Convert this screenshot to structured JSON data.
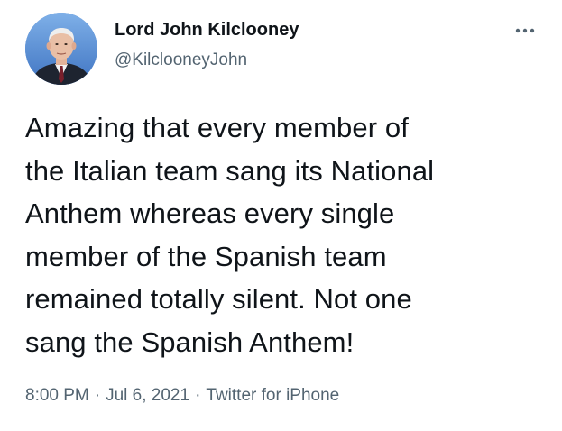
{
  "author": {
    "display_name": "Lord John Kilclooney",
    "handle": "@KilclooneyJohn",
    "avatar_icon": "profile-photo"
  },
  "more_icon": "ellipsis-icon",
  "tweet": {
    "text": "Amazing that every member of\nthe Italian team sang its National\nAnthem whereas every single\nmember of the Spanish team\nremained totally silent. Not one\nsang the Spanish Anthem!"
  },
  "meta": {
    "time": "8:00 PM",
    "separator": "·",
    "date": "Jul 6, 2021",
    "source": "Twitter for iPhone"
  },
  "colors": {
    "text_primary": "#0f1419",
    "text_secondary": "#536471",
    "avatar_background": "#5a8fd6"
  }
}
